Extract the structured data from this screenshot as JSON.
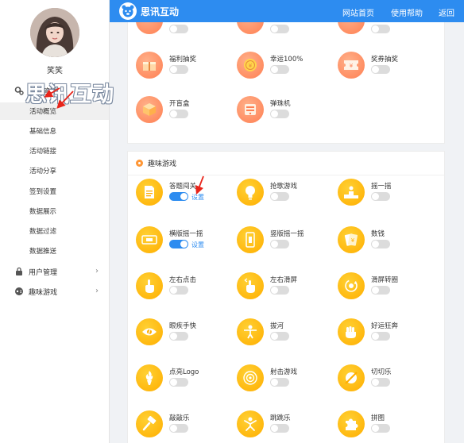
{
  "brand": {
    "name": "思讯互动"
  },
  "nav": {
    "home": "网站首页",
    "help": "使用帮助",
    "back": "返回"
  },
  "user": {
    "name": "笑笑"
  },
  "watermark": "思讯互动",
  "sidebar": {
    "group_activity": "活动管理",
    "items": [
      "活动概览",
      "基础信息",
      "活动链接",
      "活动分享",
      "签到设置",
      "数据展示",
      "数据过滤",
      "数据推送"
    ],
    "group_users": "用户管理",
    "group_games": "趣味游戏"
  },
  "lottery_card": {
    "tiles": [
      {
        "name": "福利抽奖",
        "icon": "gift-box-icon",
        "enabled": false
      },
      {
        "name": "幸运100%",
        "icon": "lucky-coin-icon",
        "enabled": false
      },
      {
        "name": "奖券抽奖",
        "icon": "ticket-icon",
        "enabled": false
      },
      {
        "name": "开盲盒",
        "icon": "blind-box-icon",
        "enabled": false
      },
      {
        "name": "弹珠机",
        "icon": "pinball-machine-icon",
        "enabled": false
      }
    ]
  },
  "games_card": {
    "title": "趣味游戏",
    "settings_label": "设置",
    "tiles": [
      {
        "name": "答题闯关",
        "icon": "quiz-document-icon",
        "enabled": true
      },
      {
        "name": "抢歌游戏",
        "icon": "light-bulb-icon",
        "enabled": false
      },
      {
        "name": "摇一摇",
        "icon": "podium-icon",
        "enabled": false
      },
      {
        "name": "横版摇一摇",
        "icon": "landscape-phone-icon",
        "enabled": true
      },
      {
        "name": "竖版摇一摇",
        "icon": "portrait-phone-icon",
        "enabled": false
      },
      {
        "name": "数钱",
        "icon": "money-icon",
        "enabled": false
      },
      {
        "name": "左右点击",
        "icon": "tap-hand-icon",
        "enabled": false
      },
      {
        "name": "左右滑屏",
        "icon": "swipe-hand-icon",
        "enabled": false
      },
      {
        "name": "滑屏转圈",
        "icon": "rotate-icon",
        "enabled": false
      },
      {
        "name": "眼疾手快",
        "icon": "eye-icon",
        "enabled": false
      },
      {
        "name": "拔河",
        "icon": "tug-of-war-icon",
        "enabled": false
      },
      {
        "name": "好运狂奔",
        "icon": "fist-icon",
        "enabled": false
      },
      {
        "name": "点亮Logo",
        "icon": "torch-icon",
        "enabled": false
      },
      {
        "name": "射击游戏",
        "icon": "target-icon",
        "enabled": false
      },
      {
        "name": "切切乐",
        "icon": "slice-icon",
        "enabled": false
      },
      {
        "name": "敲敲乐",
        "icon": "hammer-icon",
        "enabled": false
      },
      {
        "name": "跳跳乐",
        "icon": "jumping-person-icon",
        "enabled": false
      },
      {
        "name": "拼图",
        "icon": "puzzle-piece-icon",
        "enabled": false
      }
    ]
  },
  "colors": {
    "primary": "#2d8cf0",
    "orange": "#ff7f52",
    "yellow": "#ffae00",
    "annotation": "#e8241a"
  }
}
